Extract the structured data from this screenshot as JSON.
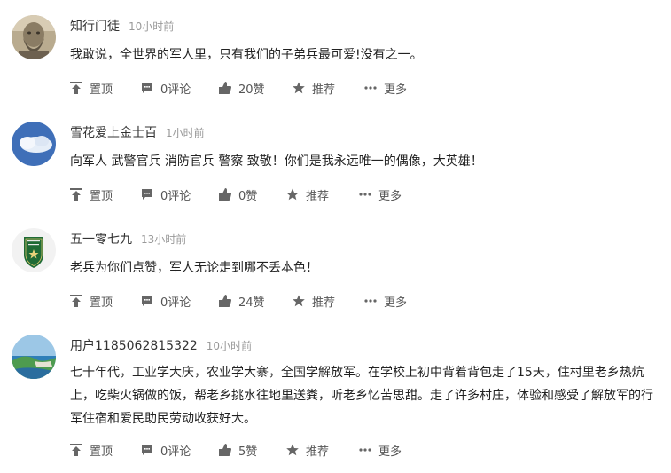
{
  "comments": [
    {
      "user": "知行门徒",
      "time": "10小时前",
      "text": "我敢说，全世界的军人里，只有我们的子弟兵最可爱!没有之一。",
      "actions": {
        "pin": "置顶",
        "comment": "0评论",
        "like": "20赞",
        "recommend": "推荐",
        "more": "更多"
      },
      "avatar_icon": "stone-statue-avatar"
    },
    {
      "user": "雪花爱上金士百",
      "time": "1小时前",
      "text": "向军人 武警官兵 消防官兵 警察 致敬！你们是我永远唯一的偶像，大英雄！",
      "actions": {
        "pin": "置顶",
        "comment": "0评论",
        "like": "0赞",
        "recommend": "推荐",
        "more": "更多"
      },
      "avatar_icon": "blue-sky-cloud-avatar"
    },
    {
      "user": "五一零七九",
      "time": "13小时前",
      "text": "老兵为你们点赞，军人无论走到哪不丢本色！",
      "actions": {
        "pin": "置顶",
        "comment": "0评论",
        "like": "24赞",
        "recommend": "推荐",
        "more": "更多"
      },
      "avatar_icon": "military-badge-avatar",
      "avatar_badge_text": "中国人民解放军\n退役军人"
    },
    {
      "user": "用户1185062815322",
      "time": "10小时前",
      "text": "七十年代，工业学大庆，农业学大寨，全国学解放军。在学校上初中背着背包走了15天，住村里老乡热炕上，吃柴火锅做的饭，帮老乡挑水往地里送粪，听老乡忆苦思甜。走了许多村庄，体验和感受了解放军的行军住宿和爱民助民劳动收获好大。",
      "actions": {
        "pin": "置顶",
        "comment": "0评论",
        "like": "5赞",
        "recommend": "推荐",
        "more": "更多"
      },
      "avatar_icon": "seaside-cliff-avatar"
    }
  ],
  "colors": {
    "name": "#333333",
    "time": "#999999",
    "text": "#222222",
    "action": "#555555",
    "icon": "#666666"
  }
}
